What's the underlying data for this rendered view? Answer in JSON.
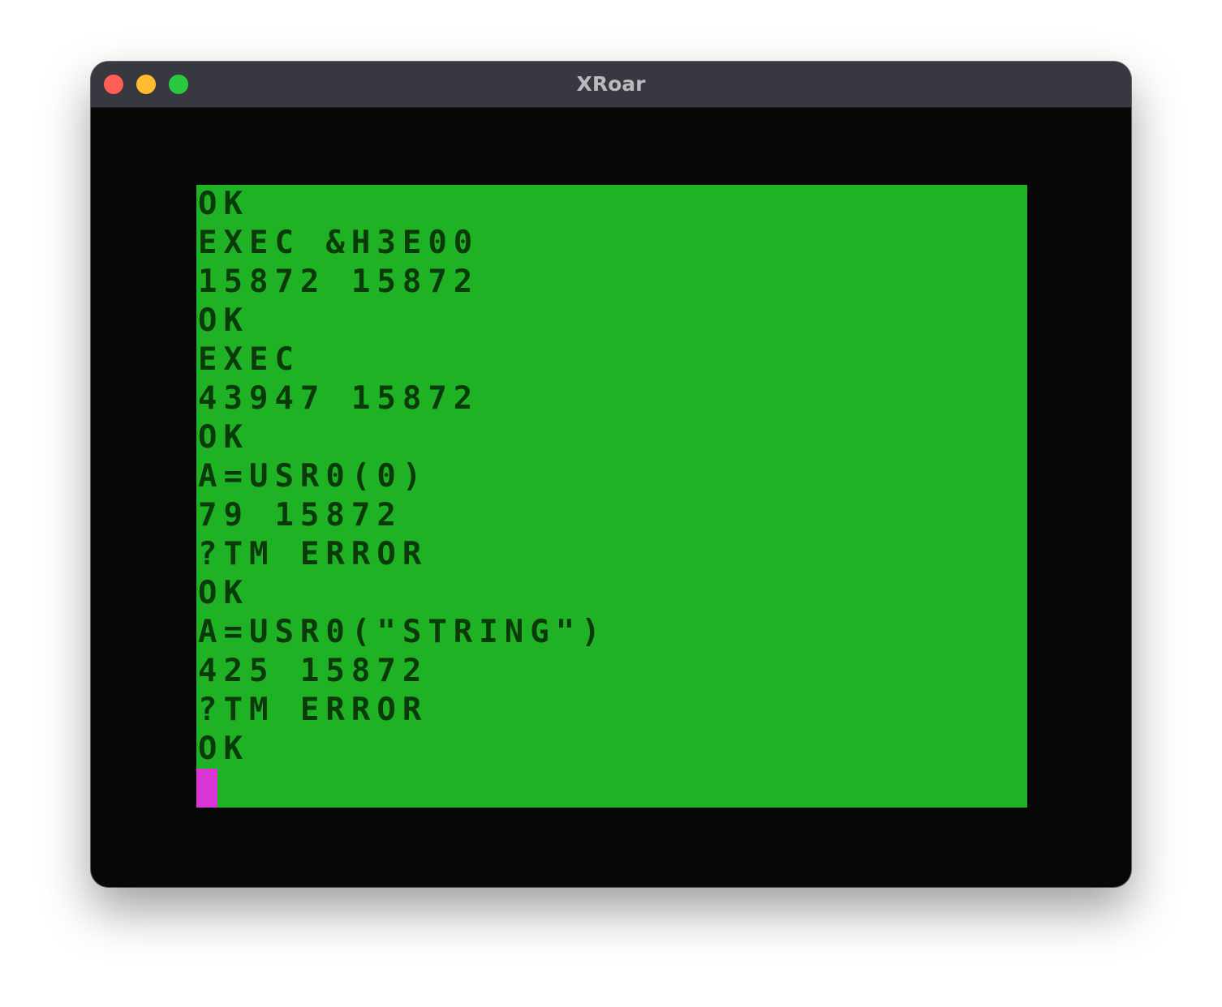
{
  "window": {
    "title": "XRoar",
    "traffic_lights": [
      "close",
      "minimize",
      "zoom"
    ]
  },
  "screen": {
    "background_color": "#1fb224",
    "text_color": "#0a3a0a",
    "cursor_color": "#d936d6",
    "lines": [
      "OK",
      "EXEC &H3E00",
      "15872 15872",
      "OK",
      "EXEC",
      "43947 15872",
      "OK",
      "A=USR0(0)",
      "79 15872",
      "?TM ERROR",
      "OK",
      "A=USR0(\"STRING\")",
      "425 15872",
      "?TM ERROR",
      "OK"
    ]
  }
}
